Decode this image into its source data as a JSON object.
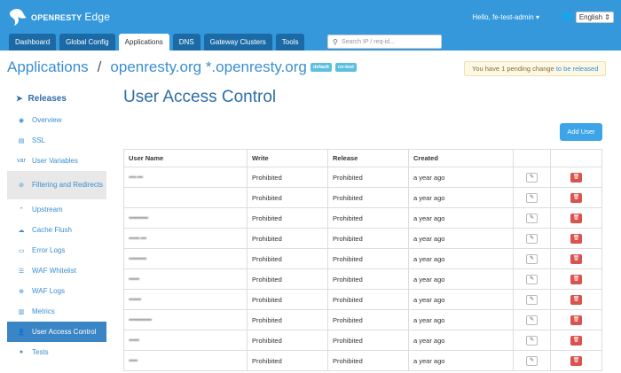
{
  "app": {
    "logo_open": "OPEN",
    "logo_resty": "RESTY",
    "logo_edge": "Edge",
    "user_greeting": "Hello, fe-test-admin",
    "language": "English"
  },
  "tabs": [
    {
      "label": "Dashboard",
      "active": false
    },
    {
      "label": "Global Config",
      "active": false
    },
    {
      "label": "Applications",
      "active": true
    },
    {
      "label": "DNS",
      "active": false
    },
    {
      "label": "Gateway Clusters",
      "active": false
    },
    {
      "label": "Tools",
      "active": false
    }
  ],
  "search": {
    "placeholder": "Search IP / req-id..."
  },
  "breadcrumb": {
    "applications": "Applications",
    "separator": "/",
    "domain": "openresty.org *.openresty.org",
    "badge_default": "default",
    "badge_cn": "cn-test"
  },
  "pending": {
    "text": "You have 1 pending change",
    "link": "to be released"
  },
  "sidebar": {
    "header": "Releases",
    "items": [
      {
        "label": "Overview",
        "icon": "overview-icon"
      },
      {
        "label": "SSL",
        "icon": "ssl-icon"
      },
      {
        "label": "User Variables",
        "icon": "var-icon"
      },
      {
        "label": "Filtering and Redirects",
        "icon": "filter-icon"
      },
      {
        "label": "Upstream",
        "icon": "upstream-icon"
      },
      {
        "label": "Cache Flush",
        "icon": "cache-icon"
      },
      {
        "label": "Error Logs",
        "icon": "error-logs-icon"
      },
      {
        "label": "WAF Whitelist",
        "icon": "waf-icon"
      },
      {
        "label": "WAF Logs",
        "icon": "waf-logs-icon"
      },
      {
        "label": "Metrics",
        "icon": "metrics-icon"
      },
      {
        "label": "User Access Control",
        "icon": "user-icon"
      },
      {
        "label": "Tests",
        "icon": "tests-icon"
      }
    ]
  },
  "main": {
    "title": "User Access Control",
    "add_button": "Add User"
  },
  "table": {
    "headers": {
      "user": "User Name",
      "write": "Write",
      "release": "Release",
      "created": "Created"
    },
    "rows": [
      {
        "user": "",
        "write": "Prohibited",
        "release": "Prohibited",
        "created": "a year ago"
      },
      {
        "user": "",
        "write": "Prohibited",
        "release": "Prohibited",
        "created": "a year ago"
      },
      {
        "user": "",
        "write": "Prohibited",
        "release": "Prohibited",
        "created": "a year ago"
      },
      {
        "user": "",
        "write": "Prohibited",
        "release": "Prohibited",
        "created": "a year ago"
      },
      {
        "user": "",
        "write": "Prohibited",
        "release": "Prohibited",
        "created": "a year ago"
      },
      {
        "user": "",
        "write": "Prohibited",
        "release": "Prohibited",
        "created": "a year ago"
      },
      {
        "user": "",
        "write": "Prohibited",
        "release": "Prohibited",
        "created": "a year ago"
      },
      {
        "user": "",
        "write": "Prohibited",
        "release": "Prohibited",
        "created": "a year ago"
      },
      {
        "user": "",
        "write": "Prohibited",
        "release": "Prohibited",
        "created": "a year ago"
      },
      {
        "user": "",
        "write": "Prohibited",
        "release": "Prohibited",
        "created": "a year ago"
      }
    ]
  },
  "colors": {
    "topbar": "#3498db",
    "accent": "#3a8ed0",
    "danger": "#d9534f"
  }
}
